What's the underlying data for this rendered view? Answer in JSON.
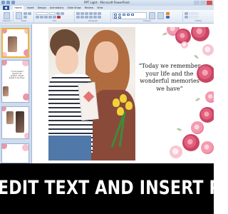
{
  "window": {
    "title": "PPT Light - Microsoft PowerPoint"
  },
  "ribbon_tabs": [
    "Home",
    "Insert",
    "Design",
    "Animations",
    "Slide Show",
    "Review",
    "View"
  ],
  "ribbon_groups": [
    "Clipboard",
    "Slides",
    "Font",
    "Paragraph",
    "Drawing",
    "Editing"
  ],
  "slide_thumbnails": [
    {
      "number": "1",
      "text": ""
    },
    {
      "number": "2",
      "text": "\"Love doesn't need to be perfect. It just needs to be true.\""
    },
    {
      "number": "3",
      "text": ""
    }
  ],
  "slide": {
    "quote": "“Today we remember your life and the wonderful memories we have”"
  },
  "banner": {
    "text": "EDIT TEXT AND INSERT PHOTOS"
  },
  "colors": {
    "banner_bg": "#000000",
    "banner_text": "#ffffff",
    "ribbon": "#dfe8f4",
    "selected_thumb": "#f2b134",
    "rose_dark": "#c94564",
    "rose_light": "#f8c6d2"
  }
}
